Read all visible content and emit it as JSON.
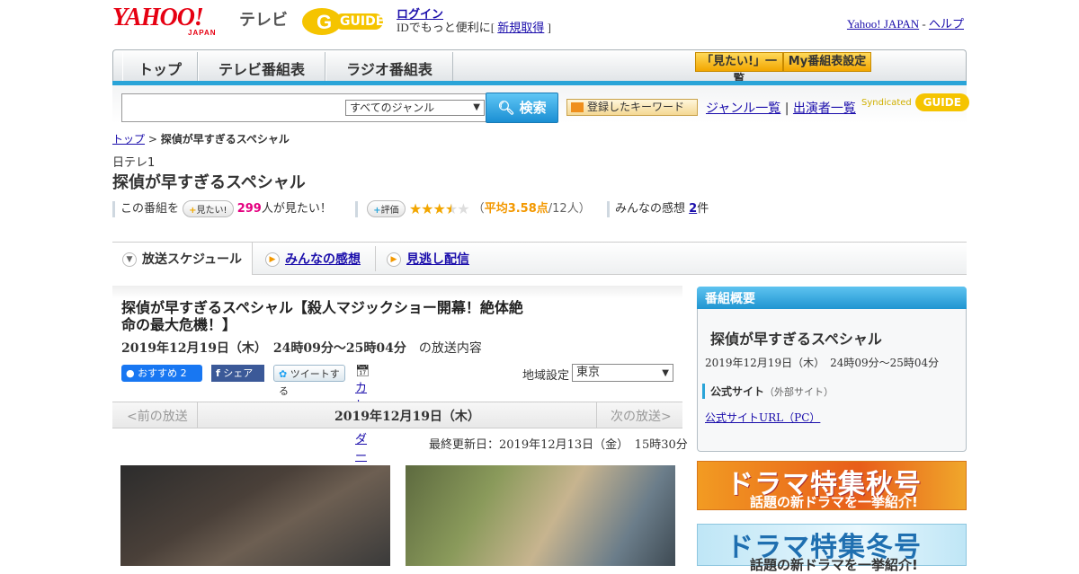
{
  "header": {
    "logo_text": "YAHOO!",
    "logo_sub": "JAPAN",
    "tv_label": "テレビ",
    "gguide_text": "GUIDE",
    "login_label": "ログイン",
    "login_pre": "IDでもっと便利に[ ",
    "register_label": "新規取得",
    "login_post": " ]",
    "yahoo_japan_link": "Yahoo! JAPAN",
    "separator": " - ",
    "help_link": "ヘルプ"
  },
  "nav": {
    "tabs": [
      "トップ",
      "テレビ番組表",
      "ラジオ番組表"
    ],
    "mitai_list": "「見たい!」一覧",
    "my_settings": "My番組表設定"
  },
  "search": {
    "placeholder": "",
    "genre_selected": "すべてのジャンル",
    "button_label": "検索",
    "keyword_button": "登録したキーワード",
    "genre_list_link": "ジャンル一覧",
    "divider": "|",
    "performer_list_link": "出演者一覧",
    "syndicated": "Syndicated"
  },
  "breadcrumb": {
    "home": "トップ",
    "sep": " > ",
    "current": "探偵が早すぎるスペシャル"
  },
  "program": {
    "channel": "日テレ1",
    "title": "探偵が早すぎるスペシャル",
    "want_pre": "この番組を",
    "want_button": "見たい!",
    "want_count": "299",
    "want_suffix": "人が見たい！",
    "rating_button": "評価",
    "rating_value": 3.58,
    "stars_on": "★★★",
    "stars_half": "★",
    "stars_off": "★",
    "rating_open": "（",
    "rating_avg": "平均3.58点",
    "rating_count": "/12人）",
    "impressions_label": "みんなの感想",
    "impressions_count": "2",
    "impressions_unit": "件"
  },
  "tabs": {
    "schedule": "放送スケジュール",
    "reviews": "みんなの感想",
    "streaming": "見逃し配信"
  },
  "episode": {
    "title": "探偵が早すぎるスペシャル【殺人マジックショー開幕！絶体絶命の最大危機！】",
    "date": "2019年12月19日（木）　24時09分～25時04分",
    "date_suffix": "の放送内容",
    "fb_recommend": "おすすめ 2",
    "fb_share": "シェア",
    "tweet": "ツイートする",
    "calendar": "カレンダーに登録",
    "region_label": "地域設定",
    "region_value": "東京",
    "prev": "<前の放送",
    "current_date": "2019年12月19日（木）",
    "next": "次の放送>",
    "updated": "最終更新日：2019年12月13日（金）　15時30分"
  },
  "sidebar": {
    "header": "番組概要",
    "title": "探偵が早すぎるスペシャル",
    "date": "2019年12月19日（木）　24時09分～25時04分",
    "official_label": "公式サイト",
    "official_note": "（外部サイト）",
    "official_link": "公式サイトURL（PC）",
    "banner1_big": "ドラマ特集秋号",
    "banner1_small": "話題の新ドラマを一挙紹介!",
    "banner2_big": "ドラマ特集冬号",
    "banner2_small": "話題の新ドラマを一挙紹介!"
  },
  "colors": {
    "accent_blue": "#2aa4d8",
    "yahoo_red": "#e60012",
    "highlight_pink": "#e4007f",
    "rating_orange": "#f39800"
  }
}
